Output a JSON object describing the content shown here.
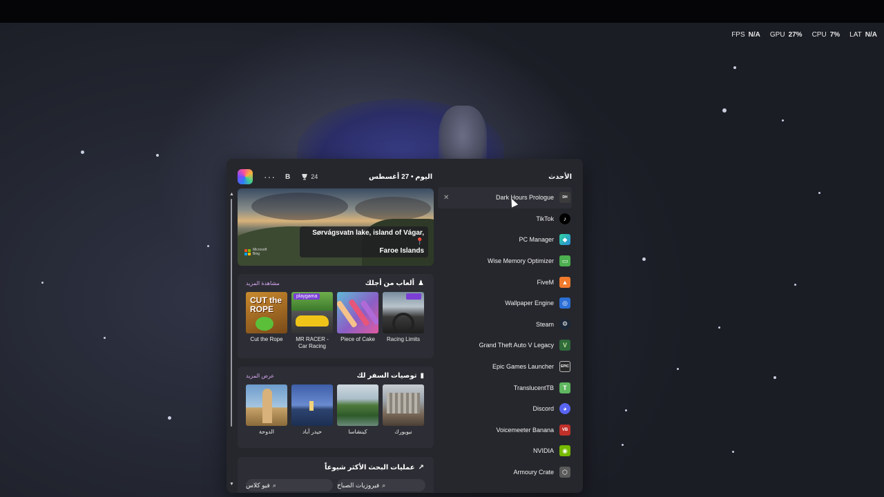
{
  "hud": {
    "fps_label": "FPS",
    "fps_value": "N/A",
    "gpu_label": "GPU",
    "gpu_value": "27%",
    "cpu_label": "CPU",
    "cpu_value": "7%",
    "lat_label": "LAT",
    "lat_value": "N/A"
  },
  "widget": {
    "header": {
      "more": "···",
      "avatar_letter": "B",
      "points": "24",
      "date": "اليوم • 27 أغسطس",
      "latest": "الأحدث"
    },
    "hero": {
      "caption_line1": "Sørvágsvatn lake, island of Vágar,",
      "caption_line2": "Faroe Islands",
      "bing_line1": "Microsoft",
      "bing_line2": "Bing"
    },
    "games": {
      "title": "ألعاب من أجلك",
      "more": "مشاهدة المزيد",
      "items": [
        {
          "label": "Cut the Rope"
        },
        {
          "label": "MR RACER - Car Racing"
        },
        {
          "label": "Piece of Cake"
        },
        {
          "label": "Racing Limits"
        }
      ],
      "badge_playgama": "playgama",
      "badge_cut": "CUT the ROPE"
    },
    "travel": {
      "title": "توصيات السفر لك",
      "more": "عرض المزيد",
      "items": [
        {
          "label": "الدوحة"
        },
        {
          "label": "حيدر آباد"
        },
        {
          "label": "كينشاسا"
        },
        {
          "label": "نيويورك"
        }
      ]
    },
    "trending": {
      "title": "عمليات البحث الأكثر شيوعاً",
      "pills": [
        "فيروزيات الصباح",
        "فيو كلاس"
      ]
    },
    "apps": [
      {
        "name": "Dark Hours Prologue",
        "icon": "DH",
        "color": "#3b3b3b"
      },
      {
        "name": "TikTok",
        "icon": "♪",
        "color": "#000000"
      },
      {
        "name": "PC Manager",
        "icon": "◆",
        "color": "#1aa4a0"
      },
      {
        "name": "Wise Memory Optimizer",
        "icon": "▭",
        "color": "#4caf50"
      },
      {
        "name": "FiveM",
        "icon": "▲",
        "color": "#f07a2c"
      },
      {
        "name": "Wallpaper Engine",
        "icon": "◎",
        "color": "#2b6fd6"
      },
      {
        "name": "Steam",
        "icon": "⚙",
        "color": "#1b2838"
      },
      {
        "name": "Grand Theft Auto V Legacy",
        "icon": "V",
        "color": "#2f6b3a"
      },
      {
        "name": "Epic Games Launcher",
        "icon": "EPIC",
        "color": "#2a2a2a"
      },
      {
        "name": "TranslucentTB",
        "icon": "T",
        "color": "#5fb760"
      },
      {
        "name": "Discord",
        "icon": "◕",
        "color": "#5865f2"
      },
      {
        "name": "Voicemeeter Banana",
        "icon": "VB",
        "color": "#c0302a"
      },
      {
        "name": "NVIDIA",
        "icon": "◉",
        "color": "#76b900"
      },
      {
        "name": "Armoury Crate",
        "icon": "⬡",
        "color": "#5a5a5a"
      }
    ]
  }
}
